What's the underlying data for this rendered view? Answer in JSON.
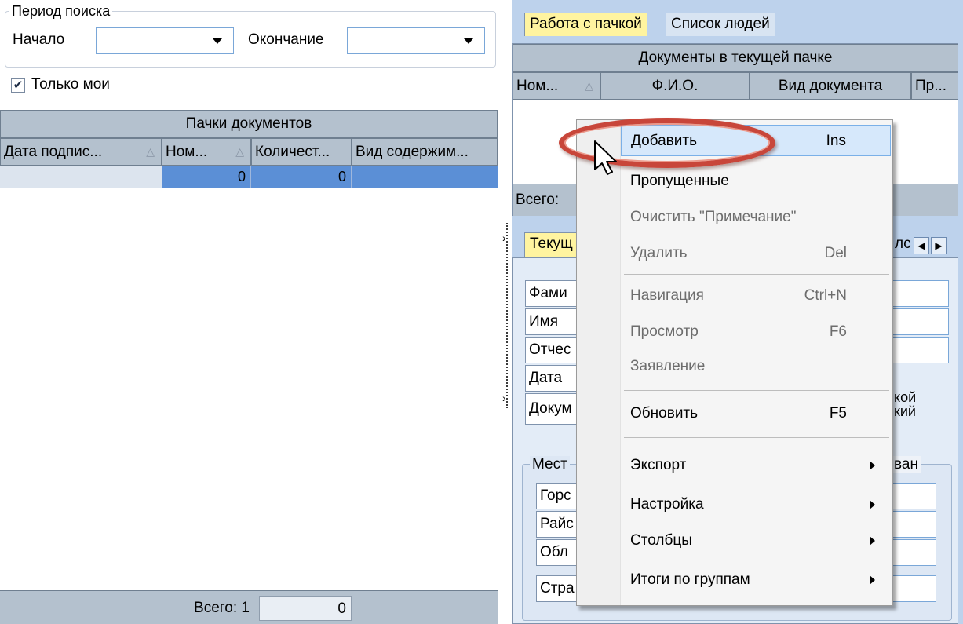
{
  "search_period": {
    "title": "Период поиска",
    "start_label": "Начало",
    "start_value": "",
    "end_label": "Окончание",
    "end_value": ""
  },
  "only_mine": {
    "label": "Только мои",
    "checked": true
  },
  "batches_grid": {
    "band_title": "Пачки документов",
    "columns": [
      "Дата подпис...",
      "Ном...",
      "Количест...",
      "Вид содержим..."
    ],
    "rows": [
      [
        "",
        "0",
        "0",
        ""
      ]
    ],
    "footer_total_label": "Всего: 1",
    "footer_total_value": "0"
  },
  "tabs_top": [
    {
      "label": "Работа с пачкой",
      "active": true
    },
    {
      "label": "Список людей",
      "active": false
    }
  ],
  "docs_grid": {
    "band_title": "Документы в текущей пачке",
    "columns": [
      "Ном...",
      "Ф.И.О.",
      "Вид документа",
      "Пр..."
    ],
    "footer_label": "Всего:"
  },
  "tabs_bottom": {
    "first_label": "Текущ",
    "clipped_label": "лс"
  },
  "person_form": {
    "labels": [
      "Фами",
      "Имя",
      "Отчес",
      "Дата",
      "Докум"
    ],
    "doc_note_lines": [
      "кой",
      "кий"
    ]
  },
  "place_group": {
    "title": "Мест",
    "badge_text": "ван",
    "labels": [
      "Горс",
      "Райс",
      "Обл",
      "Стра"
    ]
  },
  "context_menu": {
    "items": [
      {
        "label": "Добавить",
        "shortcut": "Ins",
        "enabled": true,
        "highlighted": true
      },
      {
        "label": "Пропущенные",
        "shortcut": "",
        "enabled": true
      },
      {
        "label": "Очистить \"Примечание\"",
        "shortcut": "",
        "enabled": false
      },
      {
        "label": "Удалить",
        "shortcut": "Del",
        "enabled": false
      },
      {
        "label": "Навигация",
        "shortcut": "Ctrl+N",
        "enabled": false
      },
      {
        "label": "Просмотр",
        "shortcut": "F6",
        "enabled": false
      },
      {
        "label": "Заявление",
        "shortcut": "",
        "enabled": false
      },
      {
        "label": "Обновить",
        "shortcut": "F5",
        "enabled": true
      },
      {
        "label": "Экспорт",
        "shortcut": "",
        "enabled": true,
        "submenu": true
      },
      {
        "label": "Настройка",
        "shortcut": "",
        "enabled": true,
        "submenu": true
      },
      {
        "label": "Столбцы",
        "shortcut": "",
        "enabled": true,
        "submenu": true
      },
      {
        "label": "Итоги по группам",
        "shortcut": "",
        "enabled": true,
        "submenu": true
      }
    ]
  },
  "colors": {
    "accent_highlight_ring": "#c8463a",
    "selected_row": "#5b8fd6",
    "active_tab": "#fff4a0",
    "grid_header": "#b4c1ce"
  }
}
